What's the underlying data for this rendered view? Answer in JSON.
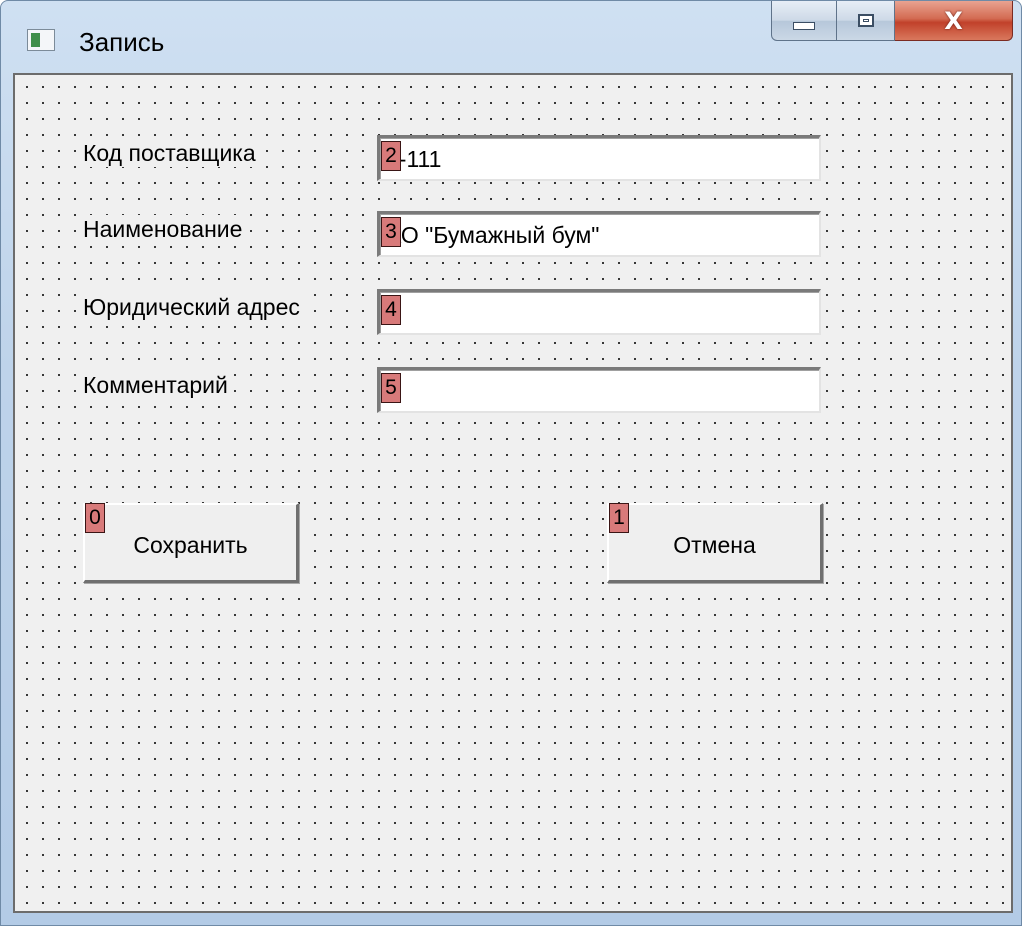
{
  "window": {
    "title": "Запись",
    "icon": "window-app-icon",
    "caption_buttons": {
      "minimize_icon": "minimize-icon",
      "maximize_icon": "maximize-icon",
      "close_icon": "close-icon",
      "close_glyph": "X"
    }
  },
  "form": {
    "fields": [
      {
        "label": "Код поставщика",
        "tab_index": "2",
        "value": "1-111"
      },
      {
        "label": "Наименование",
        "tab_index": "3",
        "value": "АО \"Бумажный бум\""
      },
      {
        "label": "Юридический адрес",
        "tab_index": "4",
        "value": ""
      },
      {
        "label": "Комментарий",
        "tab_index": "5",
        "value": ""
      }
    ],
    "buttons": {
      "save": {
        "label": "Сохранить",
        "tab_index": "0"
      },
      "cancel": {
        "label": "Отмена",
        "tab_index": "1"
      }
    }
  },
  "colors": {
    "tab_badge": "#d87a7a",
    "grid_background": "#f0f0f0",
    "close_button": "#c1412a"
  }
}
